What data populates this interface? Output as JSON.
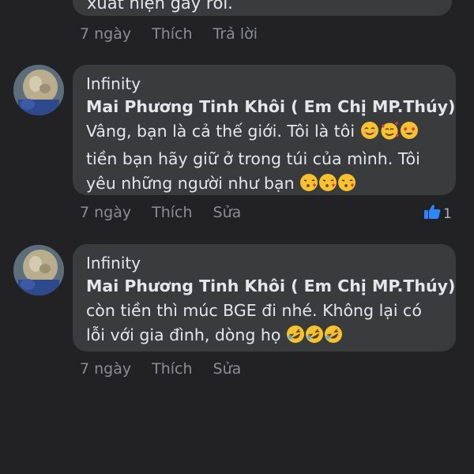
{
  "top_comment": {
    "partial_text": "xuất hiện gây rối.",
    "time": "7 ngày",
    "like_label": "Thích",
    "reply_label": "Trả lời"
  },
  "comments": [
    {
      "author": "Infinity",
      "mention": "Mai Phương Tinh Khôi ( Em Chị MP.Thúy)",
      "line1": "Vâng, bạn là cả thế giới. Tôi là tôi",
      "line2": "tiền bạn hãy giữ ở trong túi của mình. Tôi",
      "line3": "yêu những người như bạn",
      "time": "7 ngày",
      "like_label": "Thích",
      "edit_label": "Sửa",
      "reaction_count": "1"
    },
    {
      "author": "Infinity",
      "mention": "Mai Phương Tinh Khôi ( Em Chị MP.Thúy)",
      "line1": "còn tiền thì múc BGE đi nhé. Không lại có",
      "line2": "lỗi với gia đình, dòng họ",
      "time": "7 ngày",
      "like_label": "Thích",
      "edit_label": "Sửa"
    }
  ],
  "colors": {
    "background": "#222224",
    "bubble": "#3a3b3c",
    "text": "#e4e6eb",
    "meta": "#8b8d91",
    "like_blue": "#2d88ff"
  },
  "icons": {
    "emoji_set_1": [
      "smiling-face-icon",
      "smiling-face-with-hearts-icon",
      "heart-eyes-icon"
    ],
    "emoji_set_2": [
      "face-blowing-kiss-icon",
      "face-blowing-kiss-icon",
      "face-blowing-kiss-icon"
    ],
    "emoji_set_3": [
      "rolling-on-floor-laughing-icon",
      "rolling-on-floor-laughing-icon",
      "rolling-on-floor-laughing-icon"
    ],
    "reaction": "thumbs-up-icon"
  }
}
